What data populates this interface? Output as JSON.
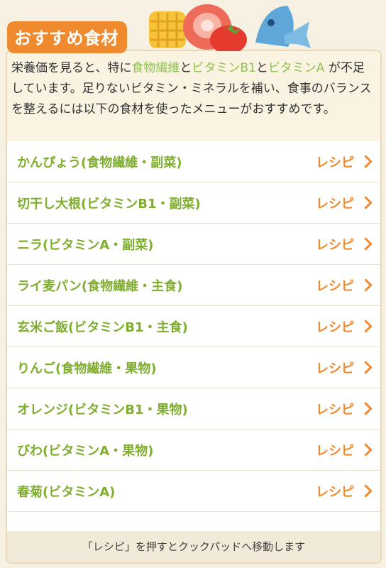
{
  "header": {
    "title": "おすすめ食材"
  },
  "intro": {
    "p1": "栄養価を見ると、特に",
    "hl1": "食物繊維",
    "p2": "と",
    "hl2": "ビタミンB1",
    "p3": "と",
    "hl3": "ビタミンA",
    "p4": " が不足しています。足りないビタミン・ミネラルを補い、食事のバランスを整えるには以下の食材を使ったメニューがおすすめです。"
  },
  "items": [
    {
      "name": "かんぴょう(食物繊維・副菜)",
      "action": "レシピ"
    },
    {
      "name": "切干し大根(ビタミンB1・副菜)",
      "action": "レシピ"
    },
    {
      "name": "ニラ(ビタミンA・副菜)",
      "action": "レシピ"
    },
    {
      "name": "ライ麦パン(食物繊維・主食)",
      "action": "レシピ"
    },
    {
      "name": "玄米ご飯(ビタミンB1・主食)",
      "action": "レシピ"
    },
    {
      "name": "りんご(食物繊維・果物)",
      "action": "レシピ"
    },
    {
      "name": "オレンジ(ビタミンB1・果物)",
      "action": "レシピ"
    },
    {
      "name": "びわ(ビタミンA・果物)",
      "action": "レシピ"
    },
    {
      "name": "春菊(ビタミンA)",
      "action": "レシピ"
    }
  ],
  "footer": {
    "note": "「レシピ」を押すとクックパッドへ移動します"
  },
  "colors": {
    "accent": "#ef8a2e",
    "green": "#7fae2e",
    "highlight": "#8fc14e",
    "bg": "#f7f1e3"
  }
}
